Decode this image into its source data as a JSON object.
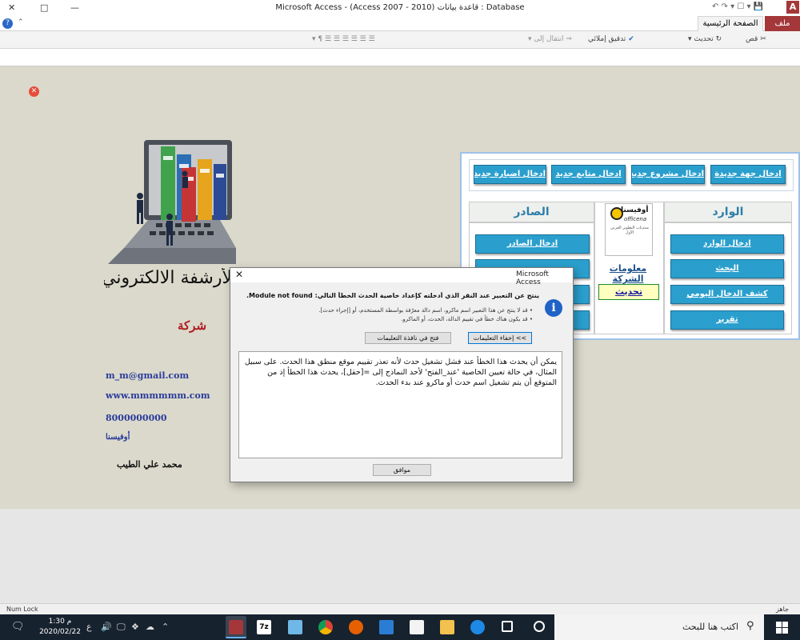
{
  "window": {
    "title": "Microsoft Access - (Access 2007 - 2010) قاعدة بيانات : Database",
    "app_letter": "A",
    "controls": {
      "minimize": "—",
      "restore": "□",
      "close": "✕"
    }
  },
  "ribbon_tabs": {
    "file": "ملف",
    "home": "الصفحة الرئيسية"
  },
  "ribbon": {
    "cut": "قص",
    "refresh": "تحديث",
    "spelling": "تدقيق إملائي",
    "goto": "انتقال إلى"
  },
  "form": {
    "title": "لأرشفة الالكتروني",
    "company": "شركة",
    "email": "m_m@gmail.com",
    "website": "www.mmmmmm.com",
    "phone": "8000000000",
    "brand": "أوفيسنا",
    "author": "محمد علي الطيب"
  },
  "panel": {
    "top_buttons": [
      "ادخال جهة جديدة",
      "ادخال مشروع جديد",
      "ادخال متابع جديد",
      "ادخال اضبارة جديدة"
    ],
    "incoming_header": "الوارد",
    "outgoing_header": "الصادر",
    "incoming_buttons": [
      "ادخال الوارد",
      "البحث",
      "كشف الدخال اليومي",
      "تقرير"
    ],
    "outgoing_buttons": [
      "ادخال الصادر"
    ],
    "logo": {
      "name": "أوفيسنا",
      "latin": "officena",
      "tagline": "منتديات التطوير العربي الأول"
    },
    "company_info": "معلومات الشركة",
    "update": "تحديث"
  },
  "dialog": {
    "caption": "Microsoft Access",
    "close": "✕",
    "icon": "i",
    "main_message": "ينتج عن التعبير عند النقر الذي أدخلته كإعداد خاصية الحدث الخطأ التالي: Module not found.",
    "bullets": [
      "قد لا ينتج عن هذا التعبير اسم ماكرو، اسم دالة معرّفة بواسطة المستخدم، أو [إجراء حدث].",
      "قد يكون هناك خطأ في تقييم الدالة، الحدث، أو الماكرو."
    ],
    "hide_help": "إخفاء التعليمات <<",
    "open_help": "فتح في نافذة التعليمات",
    "details": "يمكن أن يحدث هذا الخطأ عند فشل تشغيل حدث لأنه تعذر تقييم موقع منطق هذا الحدث. على سبيل المثال، في حالة تعيين الخاصية 'عند_الفتح' لأحد النماذج إلى =[حقل]، يحدث هذا الخطأ إذ من المتوقع أن يتم تشغيل اسم حدث أو ماكرو عند بدء الحدث.",
    "ok": "موافق"
  },
  "statusbar": {
    "left": "Num Lock",
    "right": "جاهز"
  },
  "taskbar": {
    "search_placeholder": "اكتب هنا للبحث",
    "time": "1:30 م",
    "date": "2020/02/22",
    "lang": "ع"
  },
  "colors": {
    "accent": "#a4373a",
    "button": "#2a9fcd",
    "form_bg": "#dad9cb",
    "taskbar": "#17222f"
  }
}
